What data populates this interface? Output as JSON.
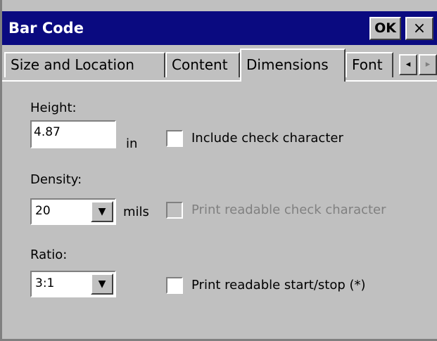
{
  "window": {
    "title": "Bar Code",
    "ok_label": "OK",
    "close_label": "×"
  },
  "tabs": [
    {
      "label": "Size and Location",
      "active": false
    },
    {
      "label": "Content",
      "active": false
    },
    {
      "label": "Dimensions",
      "active": true
    },
    {
      "label": "Font",
      "active": false
    }
  ],
  "tab_scroll": {
    "left": "◂",
    "right": "▸"
  },
  "form": {
    "height": {
      "label": "Height:",
      "value": "4.87",
      "unit": "in"
    },
    "density": {
      "label": "Density:",
      "value": "20",
      "unit": "mils",
      "drop_icon": "▼"
    },
    "ratio": {
      "label": "Ratio:",
      "value": "3:1",
      "drop_icon": "▼"
    }
  },
  "checkboxes": [
    {
      "label": "Include check character",
      "checked": false,
      "enabled": true
    },
    {
      "label": "Print readable check character",
      "checked": false,
      "enabled": false
    },
    {
      "label": "Print readable start/stop (*)",
      "checked": false,
      "enabled": true
    }
  ]
}
